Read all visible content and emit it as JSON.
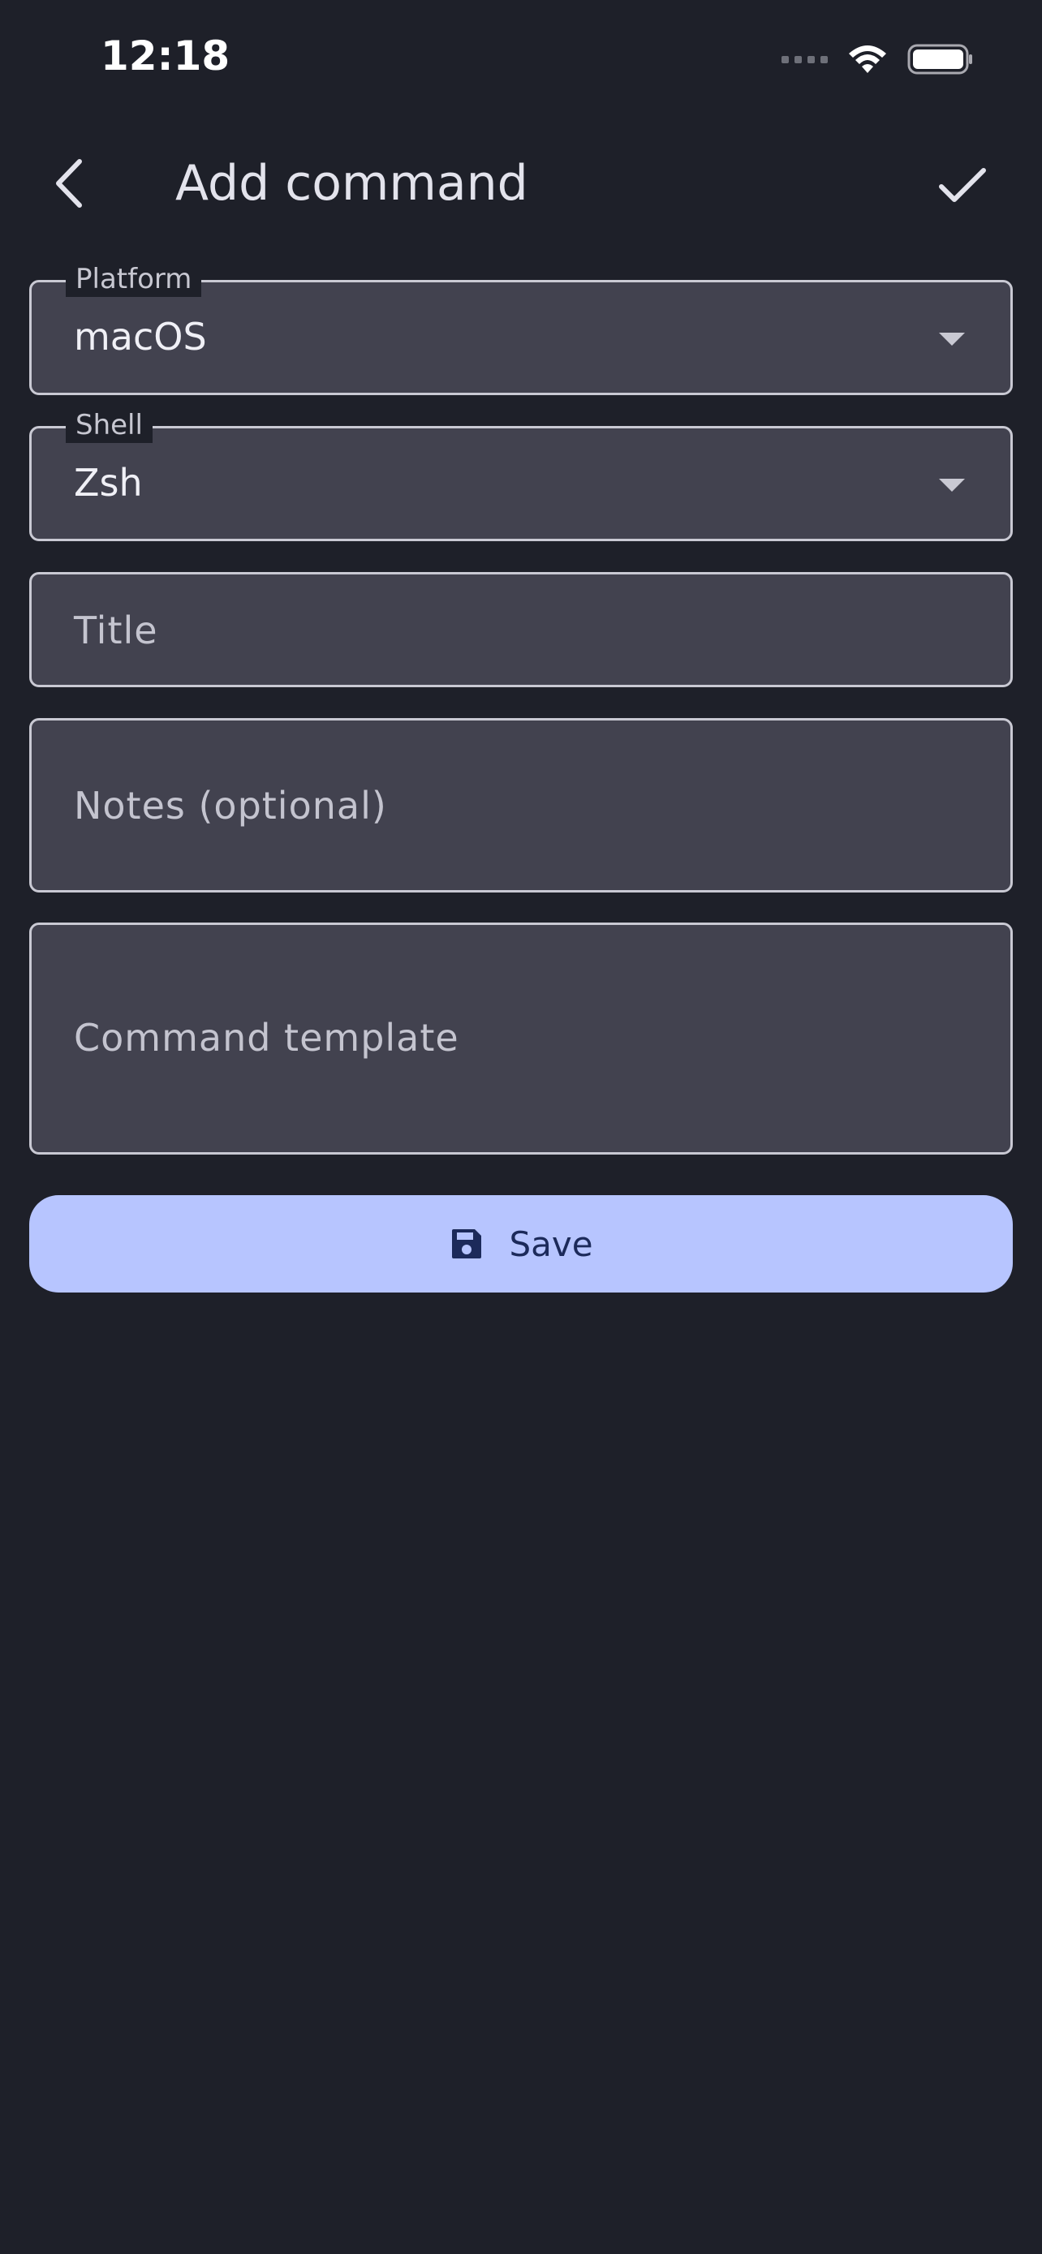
{
  "status_bar": {
    "time": "12:18",
    "icons": [
      "signal-dots-icon",
      "wifi-icon",
      "battery-icon"
    ]
  },
  "app_bar": {
    "title": "Add command",
    "back_icon": "chevron-left-icon",
    "confirm_icon": "checkmark-icon"
  },
  "form": {
    "platform": {
      "label": "Platform",
      "value": "macOS",
      "icon": "dropdown-arrow-icon"
    },
    "shell": {
      "label": "Shell",
      "value": "Zsh",
      "icon": "dropdown-arrow-icon"
    },
    "title": {
      "placeholder": "Title"
    },
    "notes": {
      "placeholder": "Notes (optional)"
    },
    "command_template": {
      "placeholder": "Command template"
    }
  },
  "save_button": {
    "label": "Save",
    "icon": "floppy-disk-icon"
  },
  "colors": {
    "background": "#1e2029",
    "field_fill": "#42424f",
    "field_border": "#c9c9d3",
    "button_fill": "#b7c5ff",
    "button_text": "#1c2a5a"
  }
}
